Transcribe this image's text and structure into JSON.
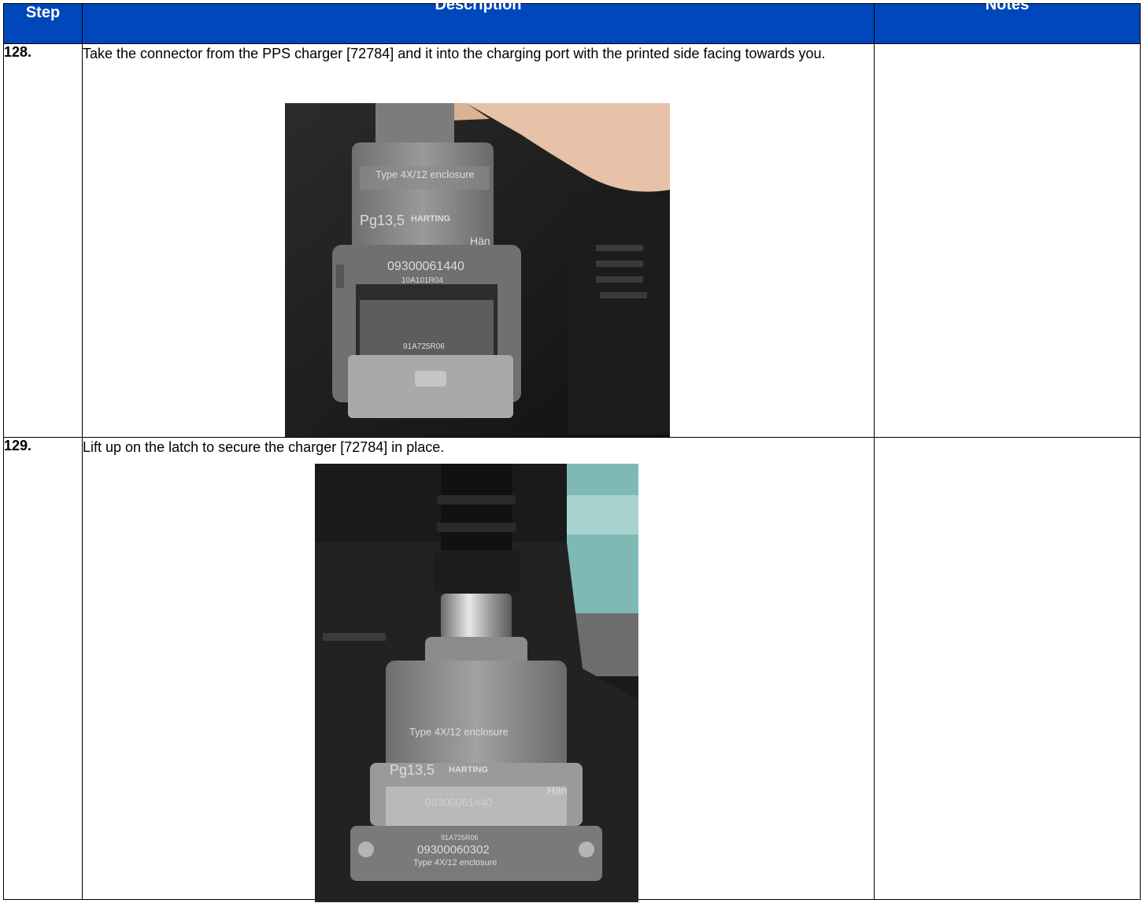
{
  "header": {
    "step_label": "Step",
    "description_label": "Description",
    "notes_label": "Notes"
  },
  "steps": [
    {
      "number": "128.",
      "text": "Take the connector from the PPS charger [72784] and it into the charging port with the printed side facing towards you.",
      "notes": "",
      "photo": {
        "labels": [
          "Type 4X/12 enclosure",
          "Pg13,5",
          "HARTING",
          "Hän",
          "09300061440",
          "10A101R04",
          "91A725R06"
        ]
      }
    },
    {
      "number": "129.",
      "text": "Lift up on the latch to secure the charger [72784] in place.",
      "notes": "",
      "photo": {
        "labels": [
          "Type 4X/12 enclosure",
          "Pg13,5",
          "HARTING",
          "Hän",
          "09300061440",
          "91A725R06",
          "09300060302",
          "Type 4X/12 enclosure"
        ]
      }
    }
  ],
  "colors": {
    "header_bg": "#0047BB",
    "header_text": "#ffffff"
  }
}
